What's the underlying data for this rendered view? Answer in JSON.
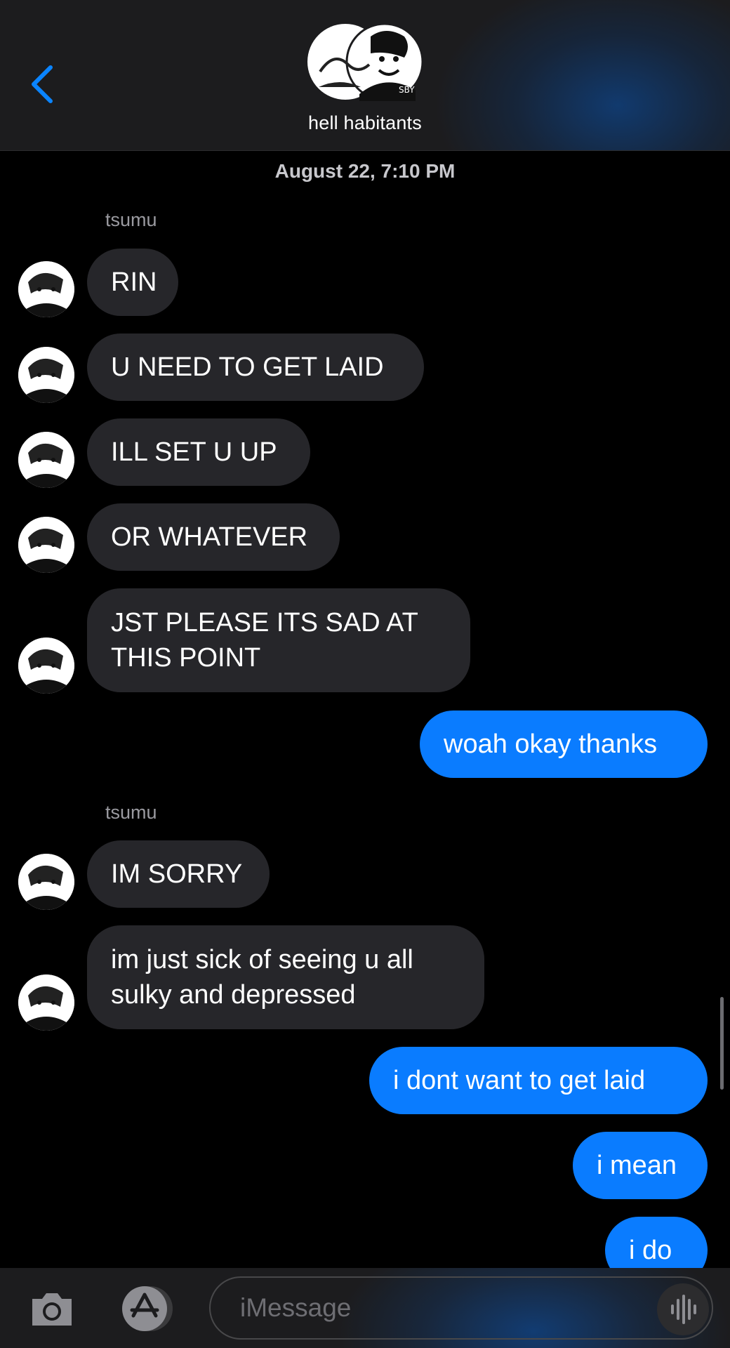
{
  "header": {
    "group_name": "hell habitants"
  },
  "thread": {
    "timestamp": "August 22, 7:10 PM",
    "sender_1": "tsumu",
    "sender_2": "tsumu",
    "messages": [
      {
        "dir": "in",
        "text": "RIN"
      },
      {
        "dir": "in",
        "text": "U NEED TO GET LAID"
      },
      {
        "dir": "in",
        "text": "ILL SET U UP"
      },
      {
        "dir": "in",
        "text": "OR WHATEVER"
      },
      {
        "dir": "in",
        "text": "JST PLEASE ITS SAD AT\nTHIS POINT"
      },
      {
        "dir": "out",
        "text": "woah okay thanks"
      },
      {
        "dir": "in",
        "text": "IM SORRY"
      },
      {
        "dir": "in",
        "text": "im just sick of seeing u all\nsulky and depressed"
      },
      {
        "dir": "out",
        "text": "i dont want to get laid"
      },
      {
        "dir": "out",
        "text": "i mean"
      },
      {
        "dir": "out",
        "text": "i do"
      }
    ]
  },
  "composer": {
    "placeholder": "iMessage"
  },
  "icons": [
    "back-chevron-icon",
    "camera-icon",
    "app-store-icon",
    "audio-waveform-icon"
  ],
  "colors": {
    "outgoing": "#0a7cff",
    "incoming": "#26262a",
    "accent": "#0a84ff"
  }
}
